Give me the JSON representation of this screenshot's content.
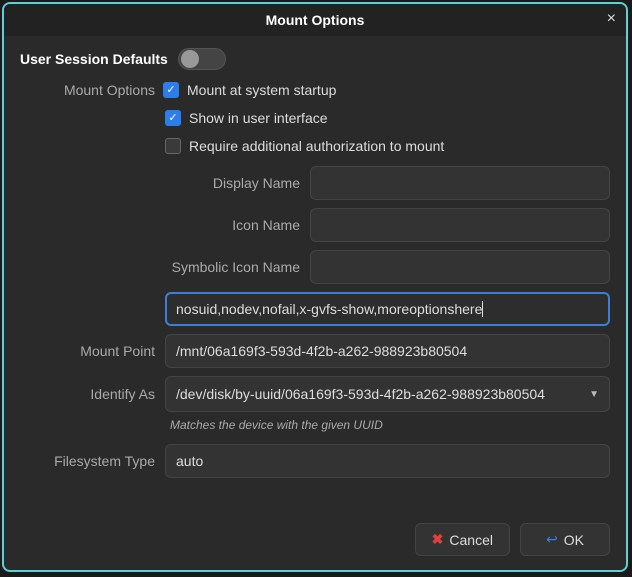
{
  "title": "Mount Options",
  "close_glyph": "×",
  "session_defaults_label": "User Session Defaults",
  "mount_options_label": "Mount Options",
  "checkboxes": {
    "startup": {
      "label": "Mount at system startup",
      "checked": true
    },
    "show_ui": {
      "label": "Show in user interface",
      "checked": true
    },
    "require_auth": {
      "label": "Require additional authorization to mount",
      "checked": false
    }
  },
  "fields": {
    "display_name": {
      "label": "Display Name",
      "value": ""
    },
    "icon_name": {
      "label": "Icon Name",
      "value": ""
    },
    "symbolic_icon_name": {
      "label": "Symbolic Icon Name",
      "value": ""
    },
    "options": {
      "value": "nosuid,nodev,nofail,x-gvfs-show,moreoptionshere"
    },
    "mount_point": {
      "label": "Mount Point",
      "value": "/mnt/06a169f3-593d-4f2b-a262-988923b80504"
    },
    "identify_as": {
      "label": "Identify As",
      "value": "/dev/disk/by-uuid/06a169f3-593d-4f2b-a262-988923b80504"
    },
    "identify_helper": "Matches the device with the given UUID",
    "filesystem_type": {
      "label": "Filesystem Type",
      "value": "auto"
    }
  },
  "buttons": {
    "cancel": "Cancel",
    "ok": "OK"
  }
}
